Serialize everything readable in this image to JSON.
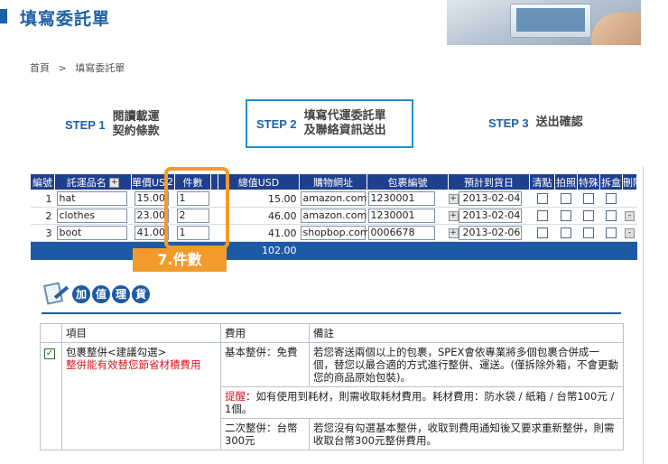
{
  "header": {
    "title": "填寫委託單"
  },
  "breadcrumb": [
    "首頁",
    ">",
    "填寫委託單"
  ],
  "steps": [
    {
      "num": "STEP 1",
      "line1": "閱讀載運",
      "line2": "契約條款"
    },
    {
      "num": "STEP 2",
      "line1": "填寫代運委託單",
      "line2": "及聯絡資訊送出"
    },
    {
      "num": "STEP 3",
      "line1": "送出確認",
      "line2": ""
    }
  ],
  "table": {
    "headers": [
      "編號",
      "託運品名",
      "單價USD",
      "2",
      "件數",
      "總值USD",
      "購物網址",
      "包裹編號",
      "預計到貨日",
      "清點",
      "拍照",
      "特殊",
      "拆盒",
      "刪除"
    ],
    "rows": [
      {
        "no": "1",
        "name": "hat",
        "price": "15.00",
        "qty": "1",
        "total": "15.00",
        "url": "amazon.com",
        "pkg": "1230001",
        "date": "2013-02-04"
      },
      {
        "no": "2",
        "name": "clothes",
        "price": "23.00",
        "qty": "2",
        "total": "46.00",
        "url": "amazon.com",
        "pkg": "1230001",
        "date": "2013-02-04"
      },
      {
        "no": "3",
        "name": "boot",
        "price": "41.00",
        "qty": "1",
        "total": "41.00",
        "url": "shopbop.com",
        "pkg": "0006678",
        "date": "2013-02-06"
      }
    ],
    "grand_total": "102.00",
    "header_btn": "+",
    "row_btn": "+",
    "delete_btn": "-"
  },
  "highlight_label": "7.件數",
  "value_added": {
    "chars": [
      "加",
      "值",
      "理",
      "貨"
    ]
  },
  "services": {
    "headers": {
      "item": "項目",
      "fee": "費用",
      "note": "備註"
    },
    "item_name": "包裹整併<建議勾選>",
    "item_sub": "整併能有效替您節省材積費用",
    "check_mark": "✓",
    "rows": [
      {
        "fee": "基本整併：免費",
        "note": "若您寄送兩個以上的包裹，SPEX會依專業將多個包裹合併成一個，替您以最合適的方式進行整併、運送。(僅拆除外箱，不會更動您的商品原始包裝)。"
      },
      {
        "reminder_label": "提醒",
        "reminder": "：如有使用到耗材，則需收取耗材費用。耗材費用：防水袋 / 紙箱 / 台幣100元 / 1個。"
      },
      {
        "fee": "二次整併：台幣300元",
        "note": "若您沒有勾選基本整併，收取到費用通知後又要求重新整併，則需收取台幣300元整併費用。"
      }
    ]
  }
}
